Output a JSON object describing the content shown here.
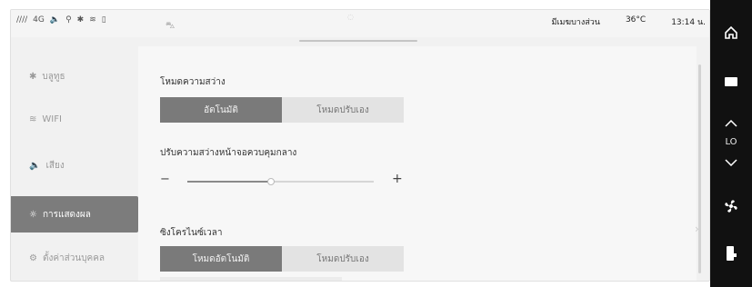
{
  "status": {
    "signal": "////",
    "network": "4G",
    "location": "มีเมฆบางส่วน",
    "temperature": "36°C",
    "time": "13:14 น."
  },
  "sidebar": {
    "items": [
      {
        "label": "บลูทูธ",
        "icon": "bluetooth-icon",
        "active": false
      },
      {
        "label": "WIFI",
        "icon": "wifi-icon",
        "active": false
      },
      {
        "label": "เสียง",
        "icon": "speaker-icon",
        "active": false
      },
      {
        "label": "การแสดงผล",
        "icon": "sun-icon",
        "active": true
      },
      {
        "label": "ตั้งค่าส่วนบุคคล",
        "icon": "gear-icon",
        "active": false
      }
    ]
  },
  "brightness_mode": {
    "title": "โหมดความสว่าง",
    "options": [
      "อัตโนมัติ",
      "โหมดปรับเอง"
    ],
    "selected": "อัตโนมัติ"
  },
  "center_brightness": {
    "title": "ปรับความสว่างหน้าจอควบคุมกลาง",
    "minus": "−",
    "plus": "+",
    "value_percent": 45
  },
  "time_sync": {
    "title": "ซิงโครไนซ์เวลา",
    "options": [
      "โหมดอัตโนมัติ",
      "โหมดปรับเอง"
    ],
    "selected": "โหมดอัตโนมัติ"
  },
  "right_panel": {
    "icons": [
      "home-icon",
      "window-icon",
      "chevron-up-icon",
      "chevron-down-icon",
      "fan-icon",
      "seat-icon"
    ],
    "climate_level": "LO"
  },
  "colors": {
    "active": "#7a7a7a",
    "inactive": "#e3e3e3",
    "panel": "#111111"
  }
}
